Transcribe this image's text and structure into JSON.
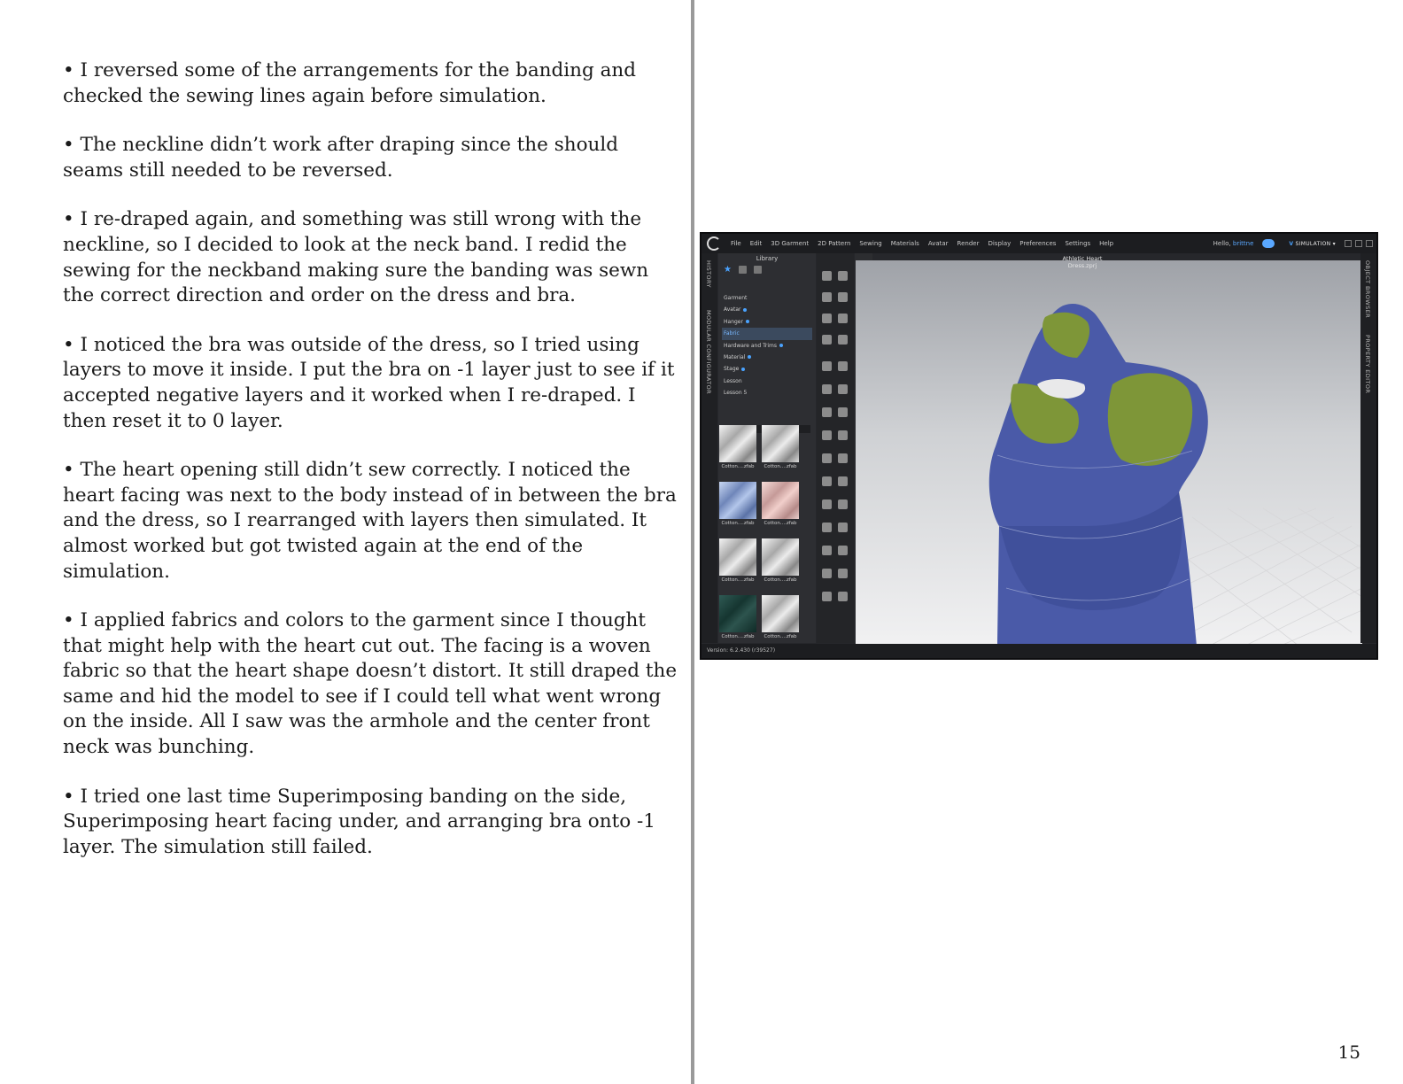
{
  "bullets": [
    "• I reversed some of the arrangements for the banding and checked the sewing lines again before simulation.",
    "• The neckline didn’t work after draping since the should seams still needed to be reversed.",
    "• I re-draped again, and something was still wrong with the neckline, so I decided to look at the neck band. I redid the sewing for the neckband making sure the banding was sewn the correct direction and order on the dress and bra.",
    "• I noticed the bra was outside of the dress, so I tried using layers to move it inside. I put the bra on -1 layer just to see if it accepted negative layers and it worked when I re-draped. I then reset it to 0 layer.",
    "• The heart opening still didn’t sew correctly. I noticed the heart facing was next to the body instead of in between the bra and the dress, so I rearranged with layers then simulated. It almost worked but got twisted again at the end of the simulation.",
    "• I applied fabrics and colors to the garment since I thought that might help with the heart cut out. The facing is a woven fabric so that the heart shape doesn’t distort. It still draped the same and hid the model to see if I could tell what went wrong on the inside. All I saw was the armhole and the center front neck was bunching.",
    "• I tried one last time Superimposing banding on the side, Superimposing heart facing under, and arranging bra onto -1 layer. The simulation still failed."
  ],
  "page_number": "15",
  "app": {
    "menu": [
      "File",
      "Edit",
      "3D Garment",
      "2D Pattern",
      "Sewing",
      "Materials",
      "Avatar",
      "Render",
      "Display",
      "Preferences",
      "Settings",
      "Help"
    ],
    "hello_prefix": "Hello,",
    "username": "brittne",
    "mode": "SIMULATION",
    "left_tabs": [
      "HISTORY",
      "MODULAR CONFIGURATOR"
    ],
    "right_tabs": [
      "OBJECT BROWSER",
      "PROPERTY EDITOR"
    ],
    "library_title": "Library",
    "tree": [
      "Garment",
      "Avatar",
      "Hanger",
      "Fabric",
      "Hardware and Trims",
      "Material",
      "Stage",
      "Lesson",
      "Lesson 5"
    ],
    "thumb_caption": "Cotton....zfab",
    "viewport_title": "Athletic Heart Dress.zprj",
    "version": "Version: 6.2.430 (r39527)"
  },
  "colors": {
    "dress": "#4a5aa8",
    "facing": "#7e9638",
    "divider": "#9a9a9a"
  }
}
